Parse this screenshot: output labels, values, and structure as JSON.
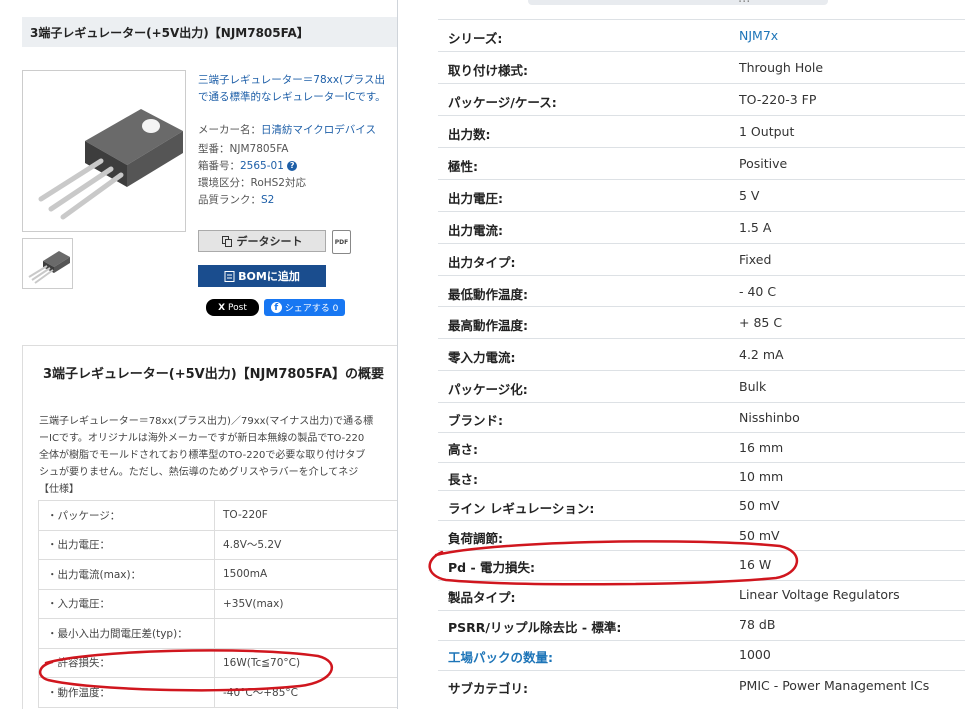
{
  "product_page": {
    "title": "3端子レギュレーター(+5V出力)【NJM7805FA】",
    "description_lines": [
      "三端子レギュレーター＝78xx(プラス出",
      "で通る標準的なレギュレーターICです。"
    ],
    "maker_label": "メーカー名：",
    "maker_value": "日清紡マイクロデバイス",
    "model_label": "型番：",
    "model_value": "NJM7805FA",
    "box_label": "箱番号：",
    "box_value": "2565-01",
    "env_label": "環境区分：",
    "env_value": "RoHS2対応",
    "quality_label": "品質ランク：",
    "quality_value": "S2",
    "datasheet_button": "データシート",
    "pdf_icon_text": "PDF",
    "bom_button": "BOMに追加",
    "x_post_button": "Post",
    "fb_share_button": "シェアする 0",
    "overview_title": "3端子レギュレーター(+5V出力)【NJM7805FA】の概要",
    "overview_lines": [
      "三端子レギュレーター＝78xx(プラス出力)／79xx(マイナス出力)で通る標",
      "ーICです。オリジナルは海外メーカーですが新日本無線の製品でTO-220",
      "全体が樹脂でモールドされており標準型のTO-220で必要な取り付けタブ",
      "シュが要りません。ただし、熱伝導のためグリスやラバーを介してネジ",
      "【仕様】"
    ],
    "spec_rows": [
      {
        "k": "・パッケージ：",
        "v": "TO-220F"
      },
      {
        "k": "・出力電圧：",
        "v": "4.8V〜5.2V"
      },
      {
        "k": "・出力電流(max)：",
        "v": "1500mA"
      },
      {
        "k": "・入力電圧：",
        "v": "+35V(max)"
      },
      {
        "k": "・最小入出力間電圧差(typ)：",
        "v": ""
      },
      {
        "k": "・許容損失：",
        "v": "16W(Tc≦70°C)"
      },
      {
        "k": "・動作温度：",
        "v": "-40°C〜+85°C"
      }
    ]
  },
  "specs_panel": {
    "cut_text": "...",
    "rows": [
      {
        "k": "シリーズ:",
        "v": "NJM7x",
        "v_link": true
      },
      {
        "k": "取り付け様式:",
        "v": "Through Hole"
      },
      {
        "k": "パッケージ/ケース:",
        "v": "TO-220-3 FP"
      },
      {
        "k": "出力数:",
        "v": "1 Output"
      },
      {
        "k": "極性:",
        "v": "Positive"
      },
      {
        "k": "出力電圧:",
        "v": "5 V"
      },
      {
        "k": "出力電流:",
        "v": "1.5 A"
      },
      {
        "k": "出力タイプ:",
        "v": "Fixed"
      },
      {
        "k": "最低動作温度:",
        "v": "- 40 C"
      },
      {
        "k": "最高動作温度:",
        "v": "+ 85 C"
      },
      {
        "k": "零入力電流:",
        "v": "4.2 mA"
      },
      {
        "k": "パッケージ化:",
        "v": "Bulk"
      },
      {
        "k": "ブランド:",
        "v": "Nisshinbo"
      },
      {
        "k": "高さ:",
        "v": "16 mm"
      },
      {
        "k": "長さ:",
        "v": "10 mm"
      },
      {
        "k": "ライン レギュレーション:",
        "v": "50 mV"
      },
      {
        "k": "負荷調節:",
        "v": "50 mV"
      },
      {
        "k": "Pd - 電力損失:",
        "v": "16 W"
      },
      {
        "k": "製品タイプ:",
        "v": "Linear Voltage Regulators"
      },
      {
        "k": "PSRR/リップル除去比 - 標準:",
        "v": "78 dB"
      },
      {
        "k": "工場パックの数量:",
        "v": "1000",
        "k_link": true
      },
      {
        "k": "サブカテゴリ:",
        "v": "PMIC - Power Management ICs"
      }
    ]
  },
  "annotation_color": "#d0161e"
}
